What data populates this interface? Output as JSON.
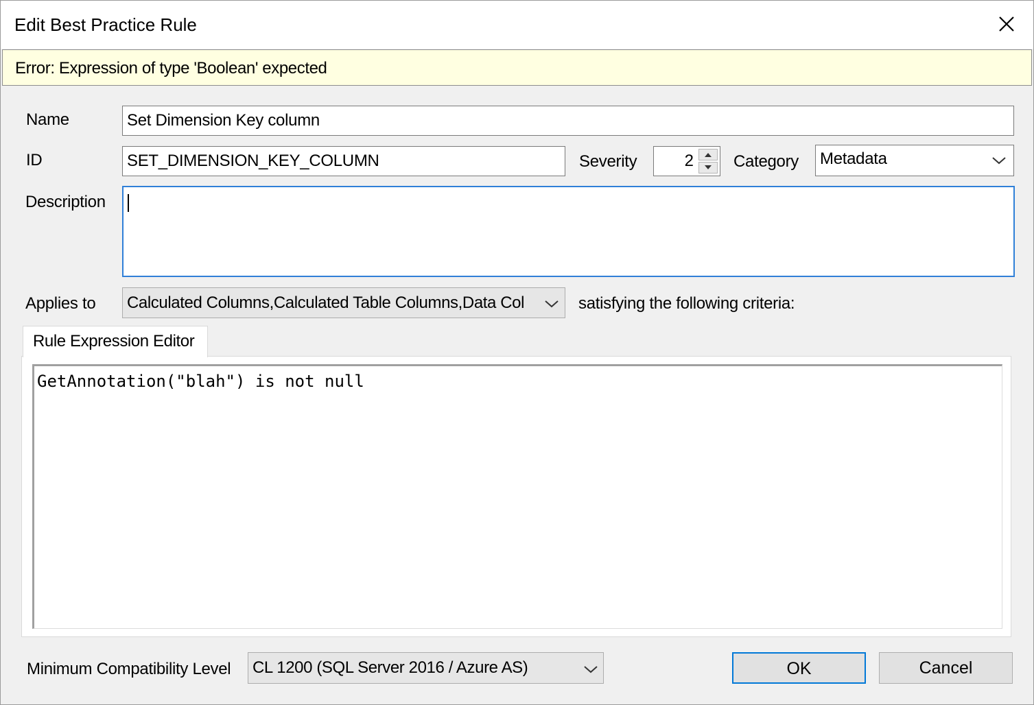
{
  "window": {
    "title": "Edit Best Practice Rule"
  },
  "error": {
    "text": "Error: Expression of type 'Boolean' expected"
  },
  "form": {
    "name_label": "Name",
    "name_value": "Set Dimension Key column",
    "id_label": "ID",
    "id_value": "SET_DIMENSION_KEY_COLUMN",
    "severity_label": "Severity",
    "severity_value": "2",
    "category_label": "Category",
    "category_value": "Metadata",
    "description_label": "Description",
    "description_value": "",
    "applies_label": "Applies to",
    "applies_value": "Calculated Columns,Calculated Table Columns,Data Col",
    "criteria_label": "satisfying the following criteria:"
  },
  "editor": {
    "tab_label": "Rule Expression Editor",
    "expression": "GetAnnotation(\"blah\") is not null"
  },
  "footer": {
    "compat_label": "Minimum Compatibility Level",
    "compat_value": "CL 1200 (SQL Server 2016 / Azure AS)",
    "ok_label": "OK",
    "cancel_label": "Cancel"
  },
  "colors": {
    "accent": "#0078d7",
    "error_bg": "#ffffe1",
    "focus_border": "#2f7fd8"
  },
  "icons": {
    "close": "close-icon",
    "dropdown": "chevron-down-icon",
    "spin_up": "caret-up-icon",
    "spin_down": "caret-down-icon"
  }
}
